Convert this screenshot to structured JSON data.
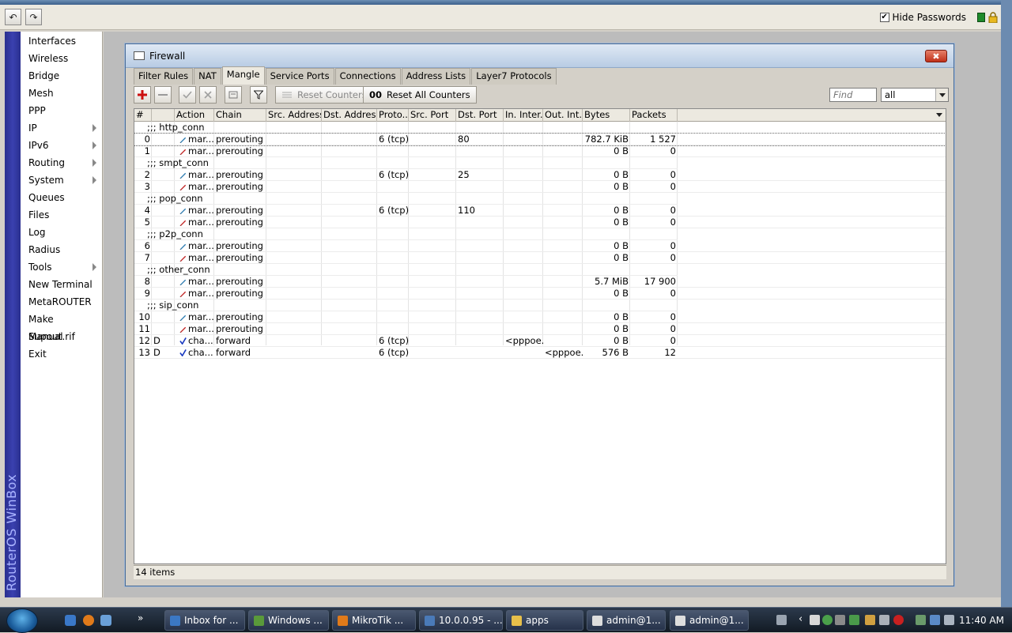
{
  "toolbar": {
    "undo_label": "↶",
    "redo_label": "↷",
    "hide_passwords_label": "Hide Passwords",
    "hide_passwords_checked": true
  },
  "brand": {
    "vertical_text": "RouterOS WinBox"
  },
  "sidebar": {
    "items": [
      {
        "label": "Interfaces",
        "has_submenu": false
      },
      {
        "label": "Wireless",
        "has_submenu": false
      },
      {
        "label": "Bridge",
        "has_submenu": false
      },
      {
        "label": "Mesh",
        "has_submenu": false
      },
      {
        "label": "PPP",
        "has_submenu": false
      },
      {
        "label": "IP",
        "has_submenu": true
      },
      {
        "label": "IPv6",
        "has_submenu": true
      },
      {
        "label": "Routing",
        "has_submenu": true
      },
      {
        "label": "System",
        "has_submenu": true
      },
      {
        "label": "Queues",
        "has_submenu": false
      },
      {
        "label": "Files",
        "has_submenu": false
      },
      {
        "label": "Log",
        "has_submenu": false
      },
      {
        "label": "Radius",
        "has_submenu": false
      },
      {
        "label": "Tools",
        "has_submenu": true
      },
      {
        "label": "New Terminal",
        "has_submenu": false
      },
      {
        "label": "MetaROUTER",
        "has_submenu": false
      },
      {
        "label": "Make Supout.rif",
        "has_submenu": false
      },
      {
        "label": "Manual",
        "has_submenu": false
      },
      {
        "label": "Exit",
        "has_submenu": false
      }
    ]
  },
  "window": {
    "title": "Firewall",
    "close_label": "✖",
    "tabs": [
      {
        "label": "Filter Rules",
        "active": false
      },
      {
        "label": "NAT",
        "active": false
      },
      {
        "label": "Mangle",
        "active": true
      },
      {
        "label": "Service Ports",
        "active": false
      },
      {
        "label": "Connections",
        "active": false
      },
      {
        "label": "Address Lists",
        "active": false
      },
      {
        "label": "Layer7 Protocols",
        "active": false
      }
    ],
    "toolbar": {
      "reset_counters_label": "Reset Counters",
      "reset_all_counters_label": "Reset All Counters",
      "reset_all_prefix": "00",
      "find_placeholder": "Find",
      "filter_value": "all"
    },
    "columns": [
      "#",
      "",
      "Action",
      "Chain",
      "Src. Address",
      "Dst. Address",
      "Proto...",
      "Src. Port",
      "Dst. Port",
      "In. Inter...",
      "Out. Int...",
      "Bytes",
      "Packets"
    ],
    "rows": [
      {
        "type": "comment",
        "text": ";;; http_conn"
      },
      {
        "type": "rule",
        "num": "0",
        "flag": "",
        "action": "mar...",
        "icon": "mark",
        "chain": "prerouting",
        "src": "",
        "dst": "",
        "proto": "6 (tcp)",
        "sport": "",
        "dport": "80",
        "in": "",
        "out": "",
        "bytes": "782.7 KiB",
        "packets": "1 527",
        "selected": true
      },
      {
        "type": "rule",
        "num": "1",
        "flag": "",
        "action": "mar...",
        "icon": "mark-red",
        "chain": "prerouting",
        "src": "",
        "dst": "",
        "proto": "",
        "sport": "",
        "dport": "",
        "in": "",
        "out": "",
        "bytes": "0 B",
        "packets": "0"
      },
      {
        "type": "comment",
        "text": ";;; smpt_conn"
      },
      {
        "type": "rule",
        "num": "2",
        "flag": "",
        "action": "mar...",
        "icon": "mark",
        "chain": "prerouting",
        "src": "",
        "dst": "",
        "proto": "6 (tcp)",
        "sport": "",
        "dport": "25",
        "in": "",
        "out": "",
        "bytes": "0 B",
        "packets": "0"
      },
      {
        "type": "rule",
        "num": "3",
        "flag": "",
        "action": "mar...",
        "icon": "mark-red",
        "chain": "prerouting",
        "src": "",
        "dst": "",
        "proto": "",
        "sport": "",
        "dport": "",
        "in": "",
        "out": "",
        "bytes": "0 B",
        "packets": "0"
      },
      {
        "type": "comment",
        "text": ";;; pop_conn"
      },
      {
        "type": "rule",
        "num": "4",
        "flag": "",
        "action": "mar...",
        "icon": "mark",
        "chain": "prerouting",
        "src": "",
        "dst": "",
        "proto": "6 (tcp)",
        "sport": "",
        "dport": "110",
        "in": "",
        "out": "",
        "bytes": "0 B",
        "packets": "0"
      },
      {
        "type": "rule",
        "num": "5",
        "flag": "",
        "action": "mar...",
        "icon": "mark-red",
        "chain": "prerouting",
        "src": "",
        "dst": "",
        "proto": "",
        "sport": "",
        "dport": "",
        "in": "",
        "out": "",
        "bytes": "0 B",
        "packets": "0"
      },
      {
        "type": "comment",
        "text": ";;; p2p_conn"
      },
      {
        "type": "rule",
        "num": "6",
        "flag": "",
        "action": "mar...",
        "icon": "mark",
        "chain": "prerouting",
        "src": "",
        "dst": "",
        "proto": "",
        "sport": "",
        "dport": "",
        "in": "",
        "out": "",
        "bytes": "0 B",
        "packets": "0"
      },
      {
        "type": "rule",
        "num": "7",
        "flag": "",
        "action": "mar...",
        "icon": "mark-red",
        "chain": "prerouting",
        "src": "",
        "dst": "",
        "proto": "",
        "sport": "",
        "dport": "",
        "in": "",
        "out": "",
        "bytes": "0 B",
        "packets": "0"
      },
      {
        "type": "comment",
        "text": ";;; other_conn"
      },
      {
        "type": "rule",
        "num": "8",
        "flag": "",
        "action": "mar...",
        "icon": "mark",
        "chain": "prerouting",
        "src": "",
        "dst": "",
        "proto": "",
        "sport": "",
        "dport": "",
        "in": "",
        "out": "",
        "bytes": "5.7 MiB",
        "packets": "17 900"
      },
      {
        "type": "rule",
        "num": "9",
        "flag": "",
        "action": "mar...",
        "icon": "mark-red",
        "chain": "prerouting",
        "src": "",
        "dst": "",
        "proto": "",
        "sport": "",
        "dport": "",
        "in": "",
        "out": "",
        "bytes": "0 B",
        "packets": "0"
      },
      {
        "type": "comment",
        "text": ";;; sip_conn"
      },
      {
        "type": "rule",
        "num": "10",
        "flag": "",
        "action": "mar...",
        "icon": "mark",
        "chain": "prerouting",
        "src": "",
        "dst": "",
        "proto": "",
        "sport": "",
        "dport": "",
        "in": "",
        "out": "",
        "bytes": "0 B",
        "packets": "0"
      },
      {
        "type": "rule",
        "num": "11",
        "flag": "",
        "action": "mar...",
        "icon": "mark-red",
        "chain": "prerouting",
        "src": "",
        "dst": "",
        "proto": "",
        "sport": "",
        "dport": "",
        "in": "",
        "out": "",
        "bytes": "0 B",
        "packets": "0"
      },
      {
        "type": "rule",
        "num": "12",
        "flag": "D",
        "action": "cha...",
        "icon": "check",
        "chain": "forward",
        "src": "",
        "dst": "",
        "proto": "6 (tcp)",
        "sport": "",
        "dport": "",
        "in": "<pppoe...",
        "out": "",
        "bytes": "0 B",
        "packets": "0"
      },
      {
        "type": "rule",
        "num": "13",
        "flag": "D",
        "action": "cha...",
        "icon": "check",
        "chain": "forward",
        "src": "",
        "dst": "",
        "proto": "6 (tcp)",
        "sport": "",
        "dport": "",
        "in": "",
        "out": "<pppoe...",
        "bytes": "576 B",
        "packets": "12"
      }
    ],
    "status_text": "14 items"
  },
  "taskbar": {
    "tasks": [
      {
        "label": "Inbox for ...",
        "color": "#3b78c4"
      },
      {
        "label": "Windows ...",
        "color": "#5a9a3a"
      },
      {
        "label": "MikroTik ...",
        "color": "#e07a1a"
      },
      {
        "label": "10.0.0.95 - ...",
        "color": "#4a7ab8"
      },
      {
        "label": "apps",
        "color": "#e8c04a"
      },
      {
        "label": "admin@1...",
        "color": "#dddddd"
      },
      {
        "label": "admin@1...",
        "color": "#dddddd"
      }
    ],
    "clock": "11:40 AM"
  },
  "colors": {
    "sidebar_brand": "#2a2f8f",
    "add_red": "#cc1010",
    "close_red": "#c0311a",
    "status_green": "#1e8a2a"
  }
}
